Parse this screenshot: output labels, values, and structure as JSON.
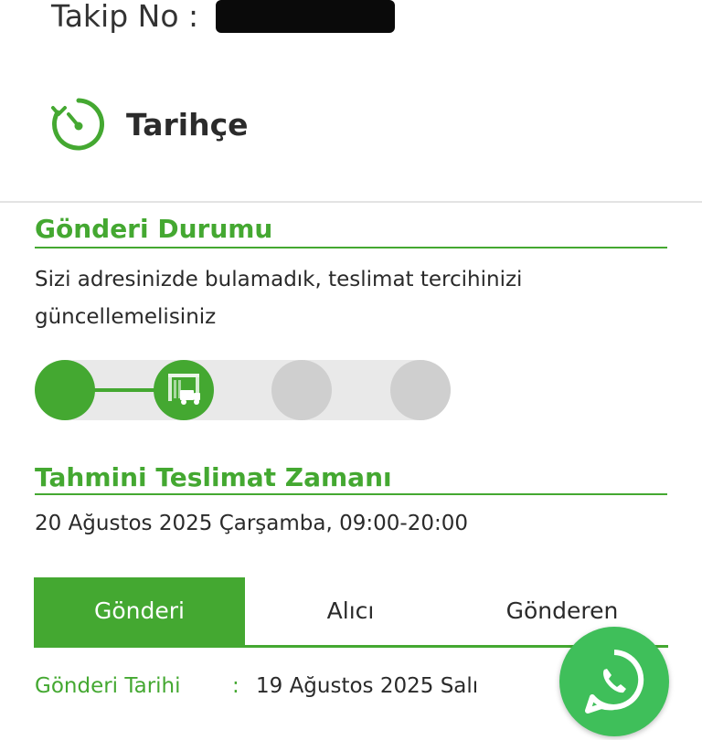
{
  "header": {
    "tracking_label": "Takip No :",
    "history_title": "Tarihçe"
  },
  "shipment_status": {
    "title": "Gönderi Durumu",
    "message": "Sizi adresinizde bulamadık, teslimat tercihinizi güncellemelisiniz",
    "progress_steps_total": 4,
    "progress_steps_completed": 2
  },
  "estimated_delivery": {
    "title": "Tahmini Teslimat Zamanı",
    "value": "20 Ağustos 2025 Çarşamba, 09:00-20:00"
  },
  "tabs": [
    {
      "label": "Gönderi",
      "active": true
    },
    {
      "label": "Alıcı",
      "active": false
    },
    {
      "label": "Gönderen",
      "active": false
    }
  ],
  "details": [
    {
      "label": "Gönderi Tarihi",
      "separator": ":",
      "value": "19 Ağustos 2025 Salı"
    }
  ],
  "colors": {
    "accent": "#44a831",
    "inactive_step": "#cfcfcf",
    "whatsapp": "#3fbf5a"
  },
  "icons": {
    "history": "clock-history-icon",
    "step2": "warehouse-truck-icon",
    "chat": "whatsapp-icon"
  }
}
